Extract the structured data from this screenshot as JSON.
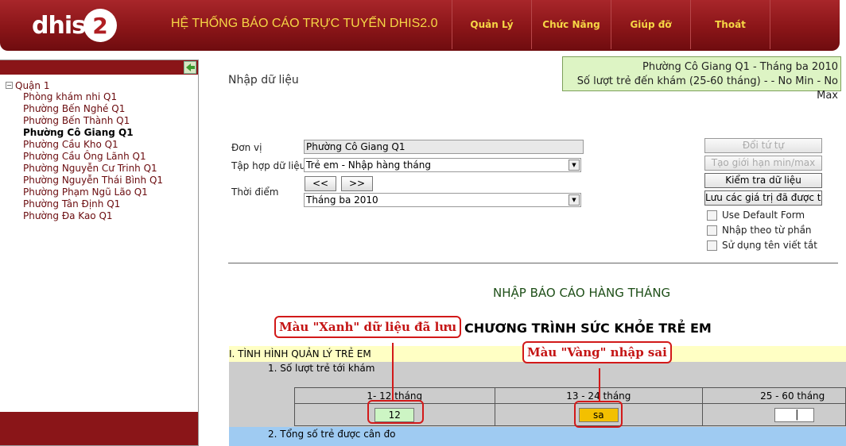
{
  "header": {
    "logo_text": "dhis",
    "logo_badge": "2",
    "system_title": "HỆ THỐNG BÁO CÁO TRỰC TUYẾN DHIS2.0",
    "nav": [
      "Quản Lý",
      "Chức Năng",
      "Giúp đỡ",
      "Thoát"
    ]
  },
  "sidebar": {
    "root": "Quận 1",
    "items": [
      "Phòng khám nhi Q1",
      "Phường Bến Nghé Q1",
      "Phường Bến Thành Q1",
      "Phường Cô Giang Q1",
      "Phường Cầu Kho Q1",
      "Phường Cầu Ông Lãnh Q1",
      "Phường Nguyễn Cư Trinh Q1",
      "Phường Nguyễn Thái Bình Q1",
      "Phường Phạm Ngũ Lão Q1",
      "Phường Tân Định Q1",
      "Phường Đa Kao Q1"
    ],
    "selected_index": 3
  },
  "page": {
    "title": "Nhập dữ liệu",
    "info_line1": "Phường Cô Giang Q1 - Tháng ba 2010",
    "info_line2": "Số lượt trẻ đến khám (25-60 tháng) - - No Min - No Max"
  },
  "form": {
    "unit_label": "Đơn vị",
    "unit_value": "Phường Cô Giang Q1",
    "dataset_label": "Tập hợp dữ liệu",
    "dataset_value": "Trẻ em - Nhập hàng tháng",
    "period_label": "Thời điểm",
    "prev_label": "<<",
    "next_label": ">>",
    "period_value": "Tháng ba 2010"
  },
  "actions": {
    "sort_order": "Đổi tứ tự",
    "gen_minmax": "Tạo giới hạn min/max",
    "validate": "Kiểm tra dữ liệu",
    "save_values": "Lưu các giá trị đã được tín",
    "use_default_form": "Use Default Form",
    "enter_by_section": "Nhập theo từ phần",
    "use_short_names": "Sử dụng tên viết tắt"
  },
  "report": {
    "title": "NHẬP BÁO CÁO HÀNG THÁNG",
    "program": "CHƯƠNG TRÌNH SỨC KHỎE TRẺ EM",
    "section1": "I. TÌNH HÌNH QUẢN LÝ TRẺ EM",
    "sub1": "1. Số lượt trẻ tới khám",
    "columns": [
      "1- 12 tháng",
      "13 - 24 tháng",
      "25 - 60 tháng"
    ],
    "values": [
      "12",
      "sa",
      ""
    ],
    "sub2": "2. Tổng số trẻ được cân đo"
  },
  "annotations": {
    "green_note": "Màu \"Xanh\" dữ liệu đã lưu",
    "yellow_note": "Màu \"Vàng\" nhập sai"
  },
  "colors": {
    "brand": "#8a1518",
    "nav_text": "#f6d645",
    "saved": "#cdf5c4",
    "error": "#f3c000",
    "annotation": "#d21919"
  }
}
